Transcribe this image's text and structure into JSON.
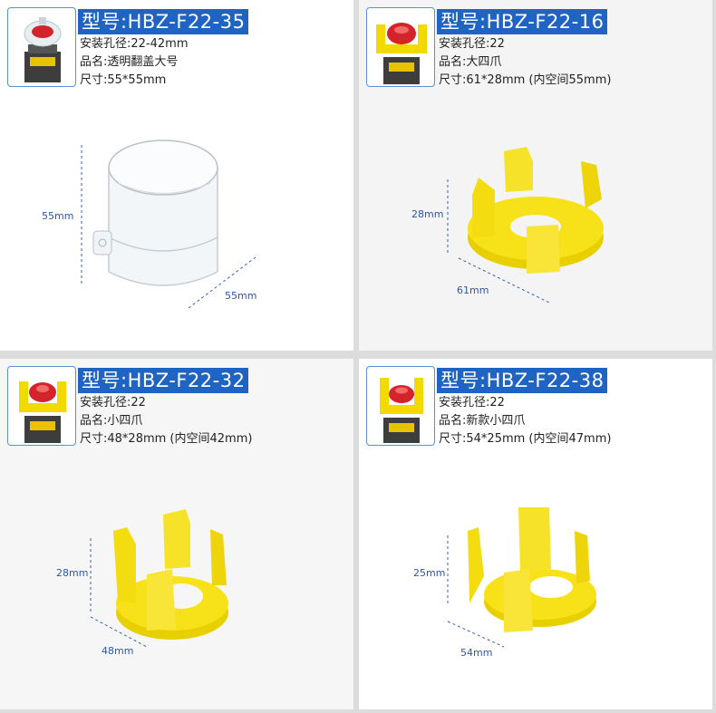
{
  "colors": {
    "badge": "#1f63c3",
    "dim_line": "#3a5fb0",
    "yellow": "#f5e10f",
    "red": "#d8202a"
  },
  "products": [
    {
      "model": "型号:HBZ-F22-35",
      "hole": "安装孔径:22-42mm",
      "name": "品名:透明翻盖大号",
      "size": "尺寸:55*55mm",
      "dims": [
        "55mm",
        "55mm"
      ]
    },
    {
      "model": "型号:HBZ-F22-16",
      "hole": "安装孔径:22",
      "name": "品名:大四爪",
      "size": "尺寸:61*28mm (内空间55mm)",
      "dims": [
        "28mm",
        "61mm"
      ]
    },
    {
      "model": "型号:HBZ-F22-32",
      "hole": "安装孔径:22",
      "name": "品名:小四爪",
      "size": "尺寸:48*28mm (内空间42mm)",
      "dims": [
        "28mm",
        "48mm"
      ]
    },
    {
      "model": "型号:HBZ-F22-38",
      "hole": "安装孔径:22",
      "name": "品名:新款小四爪",
      "size": "尺寸:54*25mm (内空间47mm)",
      "dims": [
        "25mm",
        "54mm"
      ]
    }
  ]
}
